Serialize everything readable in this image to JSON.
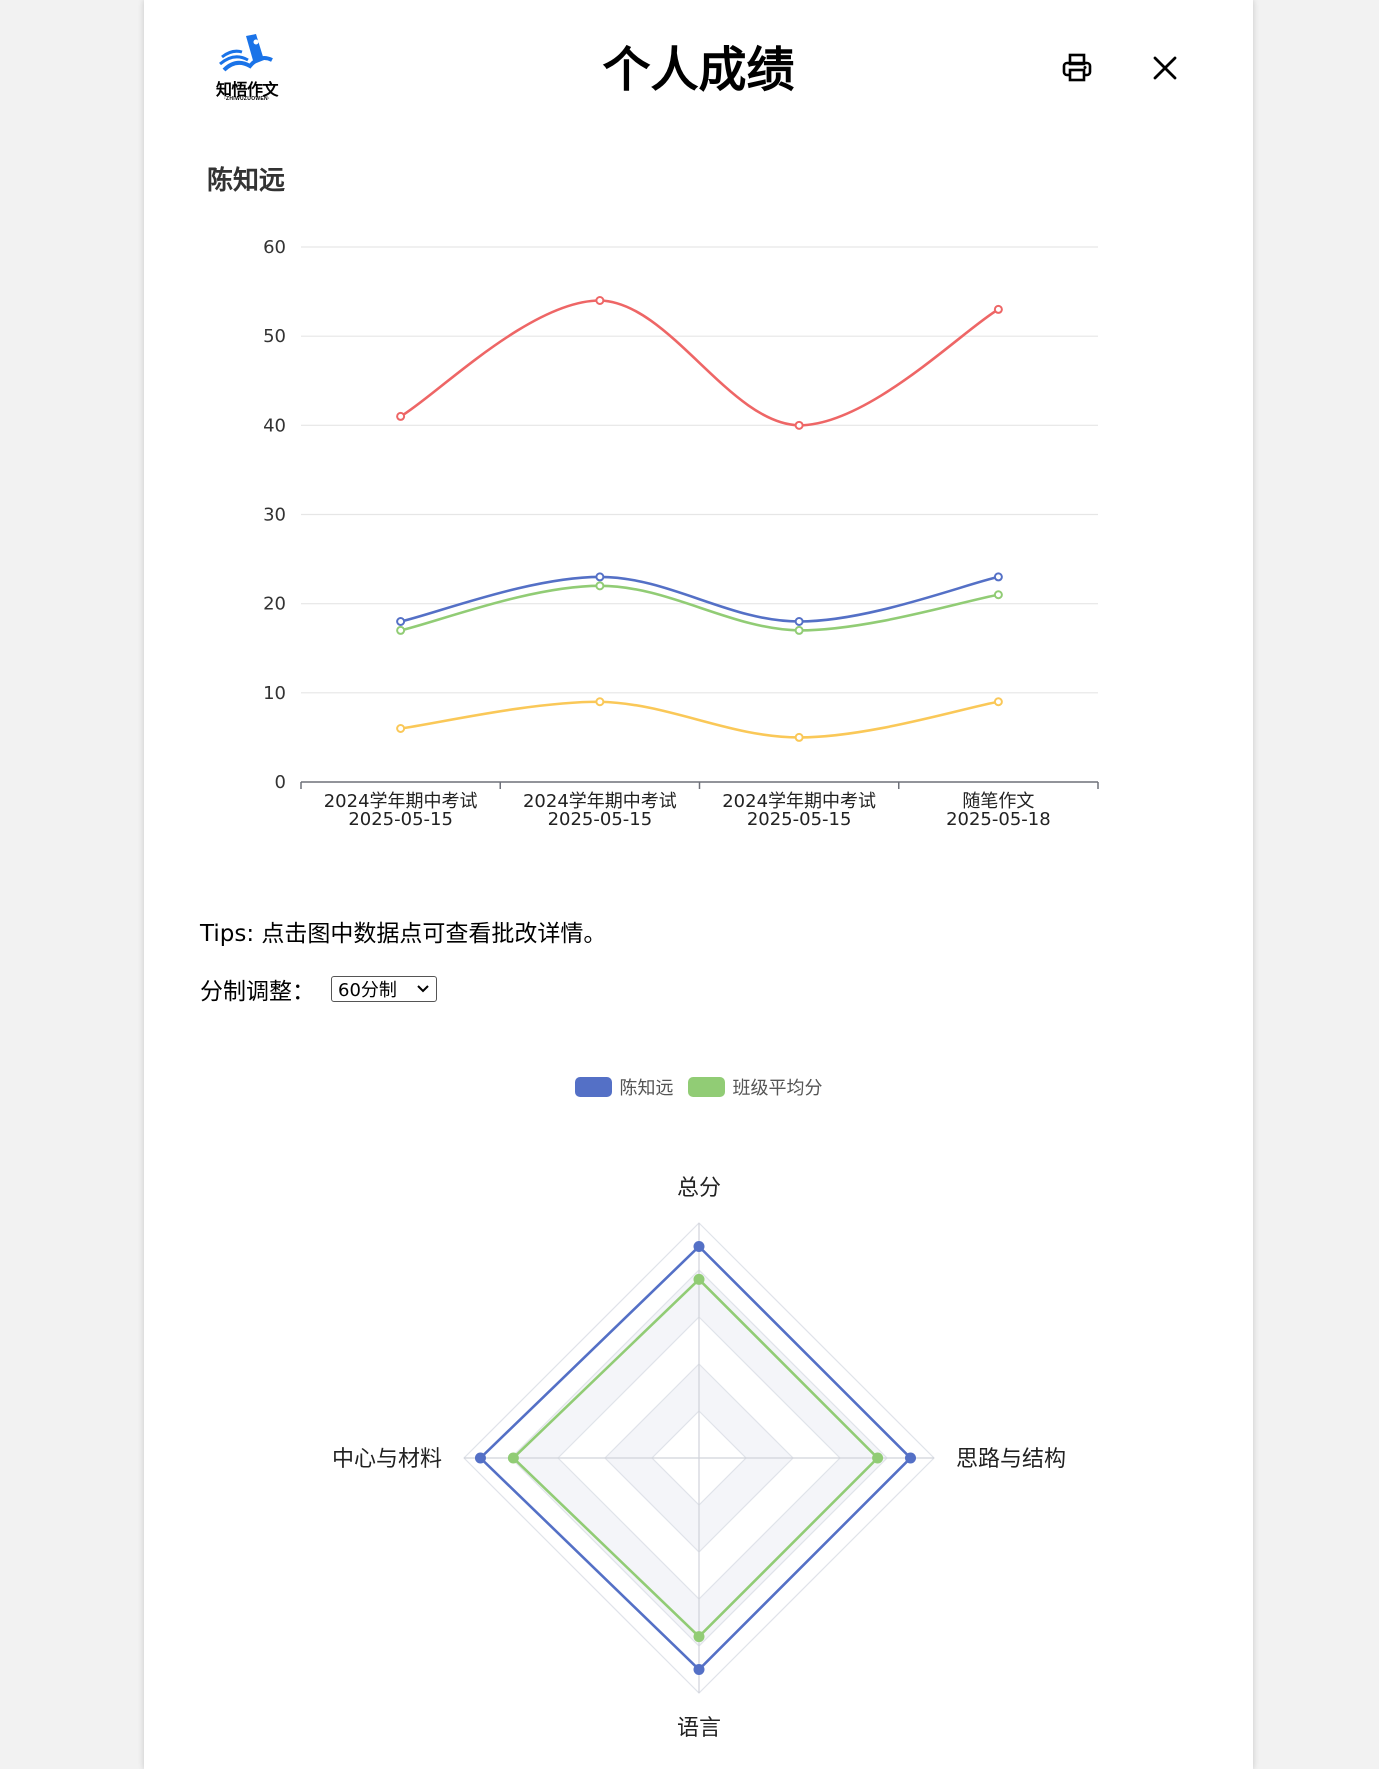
{
  "header": {
    "logo_text": "知悟作文",
    "logo_sub": "·ZHIWUZUOWEN·",
    "title": "个人成绩",
    "print_icon": "printer-icon",
    "close_icon": "close-icon"
  },
  "student": {
    "name": "陈知远"
  },
  "tips": "Tips: 点击图中数据点可查看批改详情。",
  "scale": {
    "label": "分制调整：",
    "selected": "60分制"
  },
  "colors": {
    "red": "#ee6666",
    "blue": "#5470c6",
    "green": "#91cc75",
    "yellow": "#fac858",
    "grid": "#e6e6e6",
    "axis": "#6e7079"
  },
  "chart_data": [
    {
      "type": "line",
      "smooth": true,
      "categories": [
        [
          "2024学年期中考试",
          "2025-05-15"
        ],
        [
          "2024学年期中考试",
          "2025-05-15"
        ],
        [
          "2024学年期中考试",
          "2025-05-15"
        ],
        [
          "随笔作文",
          "2025-05-18"
        ]
      ],
      "ylim": [
        0,
        60
      ],
      "yticks": [
        0,
        10,
        20,
        30,
        40,
        50,
        60
      ],
      "grid": true,
      "series": [
        {
          "color": "#ee6666",
          "values": [
            41,
            54,
            40,
            53
          ]
        },
        {
          "color": "#5470c6",
          "values": [
            18,
            23,
            18,
            23
          ]
        },
        {
          "color": "#91cc75",
          "values": [
            17,
            22,
            17,
            21
          ]
        },
        {
          "color": "#fac858",
          "values": [
            6,
            9,
            5,
            9
          ]
        }
      ]
    },
    {
      "type": "radar",
      "legend": [
        "陈知远",
        "班级平均分"
      ],
      "legend_position": "top-center",
      "indicators": [
        "总分",
        "思路与结构",
        "语言",
        "中心与材料"
      ],
      "levels": 5,
      "series": [
        {
          "name": "陈知远",
          "color": "#5470c6",
          "values": [
            0.9,
            0.9,
            0.9,
            0.93
          ]
        },
        {
          "name": "班级平均分",
          "color": "#91cc75",
          "values": [
            0.76,
            0.76,
            0.76,
            0.79
          ]
        }
      ]
    }
  ]
}
